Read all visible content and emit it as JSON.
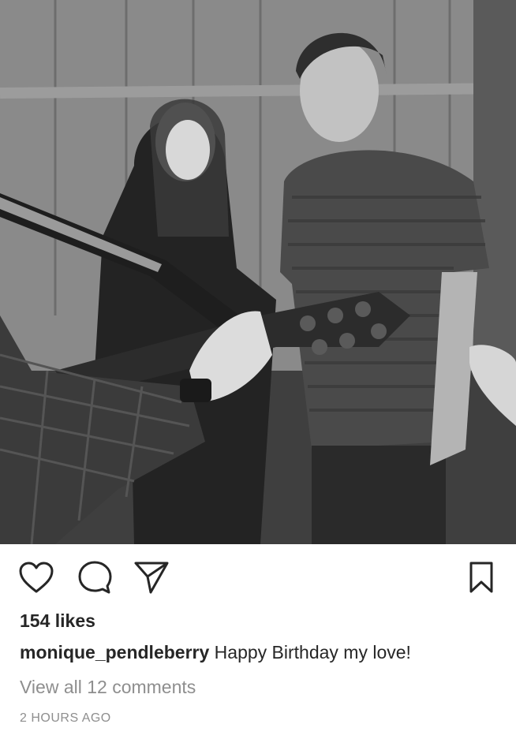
{
  "post": {
    "photo_alt": "Black and white photo of people with a guitar",
    "likes": "154 likes",
    "username": "monique_pendleberry",
    "caption": "Happy Birthday my love!",
    "view_comments": "View all 12 comments",
    "timestamp": "2 HOURS AGO"
  },
  "icons": {
    "like": "heart-icon",
    "comment": "comment-icon",
    "share": "paper-plane-icon",
    "save": "bookmark-icon"
  },
  "colors": {
    "text": "#262626",
    "muted": "#8e8e8e",
    "background": "#ffffff"
  }
}
